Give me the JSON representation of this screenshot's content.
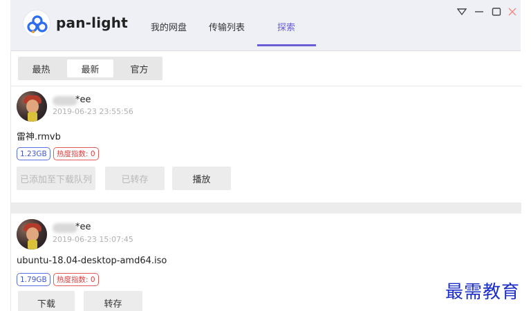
{
  "app": {
    "name": "pan-light"
  },
  "nav": {
    "tabs": [
      {
        "label": "我的网盘"
      },
      {
        "label": "传输列表"
      },
      {
        "label": "探索",
        "active": true
      }
    ]
  },
  "window_controls": [
    "menu-down-icon",
    "minimize-icon",
    "maximize-icon",
    "close-icon"
  ],
  "subtabs": [
    {
      "label": "最热"
    },
    {
      "label": "最新",
      "active": true
    },
    {
      "label": "官方"
    }
  ],
  "posts": [
    {
      "username_suffix": "*ee",
      "timestamp": "2019-06-23 23:55:56",
      "filename": "雷神.rmvb",
      "size": "1.23GB",
      "heat": "热度指数: 0",
      "buttons": [
        {
          "label": "已添加至下载队列",
          "disabled": true
        },
        {
          "label": "已转存",
          "disabled": true
        },
        {
          "label": "播放",
          "disabled": false
        }
      ]
    },
    {
      "username_suffix": "*ee",
      "timestamp": "2019-06-23 15:07:45",
      "filename": "ubuntu-18.04-desktop-amd64.iso",
      "size": "1.79GB",
      "heat": "热度指数: 0",
      "buttons": [
        {
          "label": "下载",
          "disabled": false
        },
        {
          "label": "转存",
          "disabled": false
        }
      ]
    }
  ],
  "watermark": "最需教育",
  "colors": {
    "accent": "#6a5cd6",
    "size_badge": "#3e55d4",
    "heat_badge": "#d94040",
    "watermark": "#1c2ec8"
  }
}
